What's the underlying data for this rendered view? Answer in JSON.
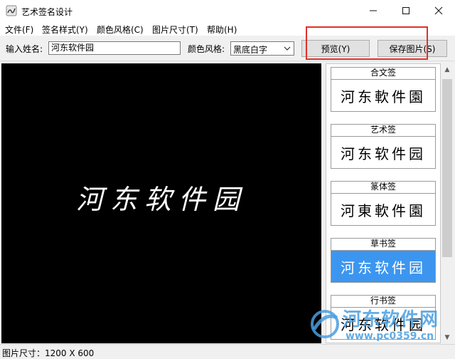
{
  "window": {
    "title": "艺术签名设计"
  },
  "menu": [
    "文件(F)",
    "签名样式(Y)",
    "颜色风格(C)",
    "图片尺寸(T)",
    "帮助(H)"
  ],
  "toolbar": {
    "name_label": "输入姓名:",
    "name_value": "河东软件园",
    "color_label": "颜色风格:",
    "color_value": "黑底白字",
    "preview_button": "预览(Y)",
    "save_button": "保存图片(S)"
  },
  "preview": {
    "text": "河东软件园"
  },
  "styles": [
    {
      "title": "合文签",
      "sample": "河东軟件園",
      "selected": false
    },
    {
      "title": "艺术签",
      "sample": "河东软件园",
      "selected": false
    },
    {
      "title": "篆体签",
      "sample": "河東軟件園",
      "selected": false
    },
    {
      "title": "草书签",
      "sample": "河东软件园",
      "selected": true
    },
    {
      "title": "行书签",
      "sample": "河东软件园",
      "selected": false
    }
  ],
  "status": {
    "text": "图片尺寸：1200 X 600"
  },
  "watermark": {
    "name": "河东软件网",
    "url": "www.pc0359.cn"
  },
  "colors": {
    "selected_bg": "#3c96f0",
    "highlight": "#e0302a",
    "watermark": "#4a9ee0"
  }
}
